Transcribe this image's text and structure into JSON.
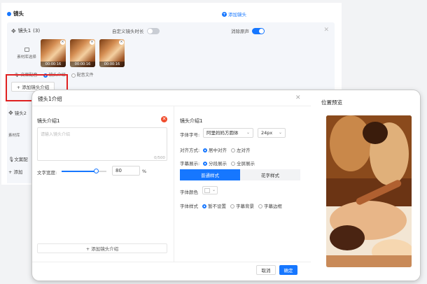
{
  "section": {
    "title": "镜头",
    "add_shot": "添加镜头"
  },
  "shot1": {
    "name": "镜头1",
    "count": "(3)",
    "custom_duration_label": "自定义镜头时长",
    "mute_label": "消除原声",
    "library_label": "素材库选择",
    "clips": [
      {
        "duration": "00:00:16"
      },
      {
        "duration": "00:00:16"
      },
      {
        "duration": "00:00:16"
      }
    ],
    "options": [
      "文案配音",
      "镜头介绍",
      "配音文件"
    ],
    "add_intro": "+ 添加镜头介绍"
  },
  "shot2": {
    "name": "镜头2",
    "library_label": "素材库",
    "voice_label": "文案配",
    "add_intro": "+ 添加"
  },
  "modal": {
    "title": "镜头1介绍",
    "left": {
      "label": "镜头介绍1",
      "placeholder": "请输入镜头介绍",
      "counter": "0/500",
      "width_label": "文字宽度:",
      "width_value": "80",
      "width_unit": "%",
      "width_percent": 80,
      "add_intro": "+ 添加镜头介绍"
    },
    "right": {
      "label": "镜头介绍1",
      "font_label": "字体字号:",
      "font_value": "阿里妈妈方圆体",
      "size_value": "24px",
      "align_label": "对齐方式:",
      "align_options": [
        "居中对齐",
        "左对齐"
      ],
      "display_label": "字幕展示:",
      "display_options": [
        "分段展示",
        "全屏展示"
      ],
      "tab_normal": "普通样式",
      "tab_fancy": "花字样式",
      "color_label": "字体颜色",
      "style_label": "字体样式",
      "style_options": [
        "暂不设置",
        "字幕背景",
        "字幕边框"
      ]
    },
    "cancel": "取消",
    "confirm": "确定"
  },
  "preview": {
    "title": "位置预览"
  },
  "colors": {
    "accent": "#1677ff",
    "error": "#f04a2a",
    "highlight": "#e02020"
  }
}
